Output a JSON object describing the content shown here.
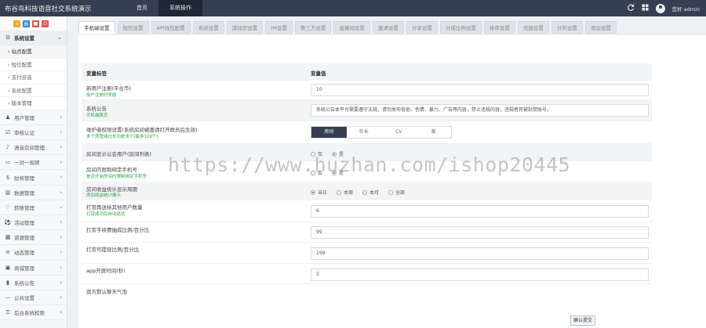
{
  "topbar": {
    "title": "布谷鸟科技语音社交系统演示",
    "nav": [
      "首页",
      "系统操作"
    ],
    "right_icons": [
      "refresh-icon",
      "grid-icon"
    ],
    "user": "您好 admin"
  },
  "sidebar": {
    "shortcut_colors": [
      "#f0a32c",
      "#2d8bd6",
      "#e35454",
      "#e35454"
    ],
    "open_group": {
      "label": "系统设置",
      "icon": "gear-icon"
    },
    "sub_items": [
      "站点配置",
      "短信配置",
      "支付自选",
      "系统配置",
      "版本管理"
    ],
    "groups": [
      {
        "label": "用户管理",
        "icon": "user-icon"
      },
      {
        "label": "审核认证",
        "icon": "check-icon"
      },
      {
        "label": "语音房间管理",
        "icon": "mic-icon"
      },
      {
        "label": "一对一视频",
        "icon": "video-icon"
      },
      {
        "label": "财务管理",
        "icon": "money-icon"
      },
      {
        "label": "数据管理",
        "icon": "chart-icon"
      },
      {
        "label": "转移管理",
        "icon": "heart-icon"
      },
      {
        "label": "活动管理",
        "icon": "ball-icon"
      },
      {
        "label": "资源管理",
        "icon": "gift-icon"
      },
      {
        "label": "动态管理",
        "icon": "list-icon"
      },
      {
        "label": "商城管理",
        "icon": "shop-icon"
      },
      {
        "label": "系统公告",
        "icon": "bookmark-icon"
      },
      {
        "label": "公共设置",
        "icon": "minus-icon"
      },
      {
        "label": "后台系统权限",
        "icon": "lock-icon"
      }
    ]
  },
  "tabs": [
    "手机端设置",
    "短信设置",
    "API钱包配置",
    "系统设置",
    "游戏页设置",
    "IM设置",
    "第三方设置",
    "直播间设置",
    "邀请设置",
    "分享设置",
    "分成比例设置",
    "排序设置",
    "充值设置",
    "分布设置",
    "添加设置"
  ],
  "table": {
    "col1": "变量标签",
    "col2": "变量值",
    "rows": [
      {
        "label": "新用户注册(平台币)",
        "hint": "用户注册时奖励",
        "value": "10"
      },
      {
        "label": "系统公告",
        "hint": "手机端首页",
        "value": "系统公告本平台需要遵守法规，请勿发布低俗、色情、暴力、广告等内容，禁止违规内容，违规者将被封禁账号。"
      },
      {
        "label": "维护者权限设置(系统房间被邀请打开群员后生效)",
        "hint": "多个房管或社长均是多少(最多100个)",
        "seg": [
          "房间",
          "社长",
          "CV",
          "家"
        ],
        "seg_on": 0
      },
      {
        "label": "房间显示公会用户(房间列表)",
        "radios": [
          "否",
          "是"
        ],
        "radio_on": 1
      },
      {
        "label": "房间内限制绑定手机号",
        "hint": "是否开启房间内限制绑定手机号",
        "radios": [
          "否",
          "是"
        ],
        "radio_on": 1
      },
      {
        "label": "房间收益统计显示周期",
        "hint": "房间收益统计展示",
        "radios": [
          "当日",
          "本周",
          "本月",
          "全部"
        ],
        "radio_on": 0
      },
      {
        "label": "打赏再送给其他用户数量",
        "hint": "打赏成功后自动送达",
        "value": "6"
      },
      {
        "label": "打赏手续费抽成比例/百分比",
        "value": "99"
      },
      {
        "label": "打赏可提现比例/百分比",
        "value": "199"
      },
      {
        "label": "app开屏时间(秒)",
        "value": "3"
      },
      {
        "label": "双方默认聊天气泡"
      }
    ],
    "submit": "确认提交"
  },
  "watermark": "https://www.huzhan.com/ishop20445"
}
